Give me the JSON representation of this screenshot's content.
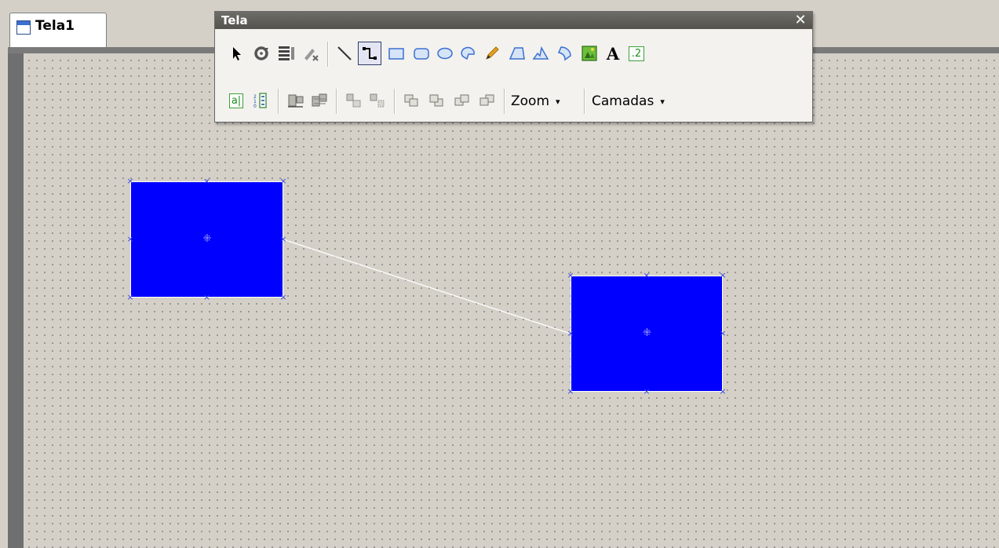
{
  "tab": {
    "label": "Tela1"
  },
  "toolbar": {
    "title": "Tela",
    "close_glyph": "✕",
    "text_tool_glyph": "A",
    "number_tool_glyph": ".2",
    "display_tool_glyph": "a|",
    "zoom_label": "Zoom",
    "layers_label": "Camadas",
    "dropdown_arrow": "▾",
    "active_tool": "connector-tool"
  },
  "colors": {
    "shape_fill": "#0000ff",
    "handle": "#3b49d8",
    "connector_line": "#ffffff",
    "canvas_background": "#d4d0c8",
    "title_bar": "#5f5e59"
  },
  "icons": {
    "row1": [
      "pointer-icon",
      "rotate-icon",
      "list-icon",
      "eraser-icon",
      "line-icon",
      "connector-icon",
      "rectangle-icon",
      "rounded-rectangle-icon",
      "ellipse-icon",
      "arc-icon",
      "pencil-icon",
      "polygon-icon",
      "freeform-icon",
      "bitmap-icon",
      "text-icon",
      "number-display-icon"
    ],
    "row2": [
      "display-field-icon",
      "list-numbers-icon",
      "align-left-icon",
      "align-right-icon",
      "group-icon",
      "ungroup-icon",
      "bring-front-icon",
      "send-back-icon",
      "bring-forward-icon",
      "send-backward-icon"
    ]
  }
}
